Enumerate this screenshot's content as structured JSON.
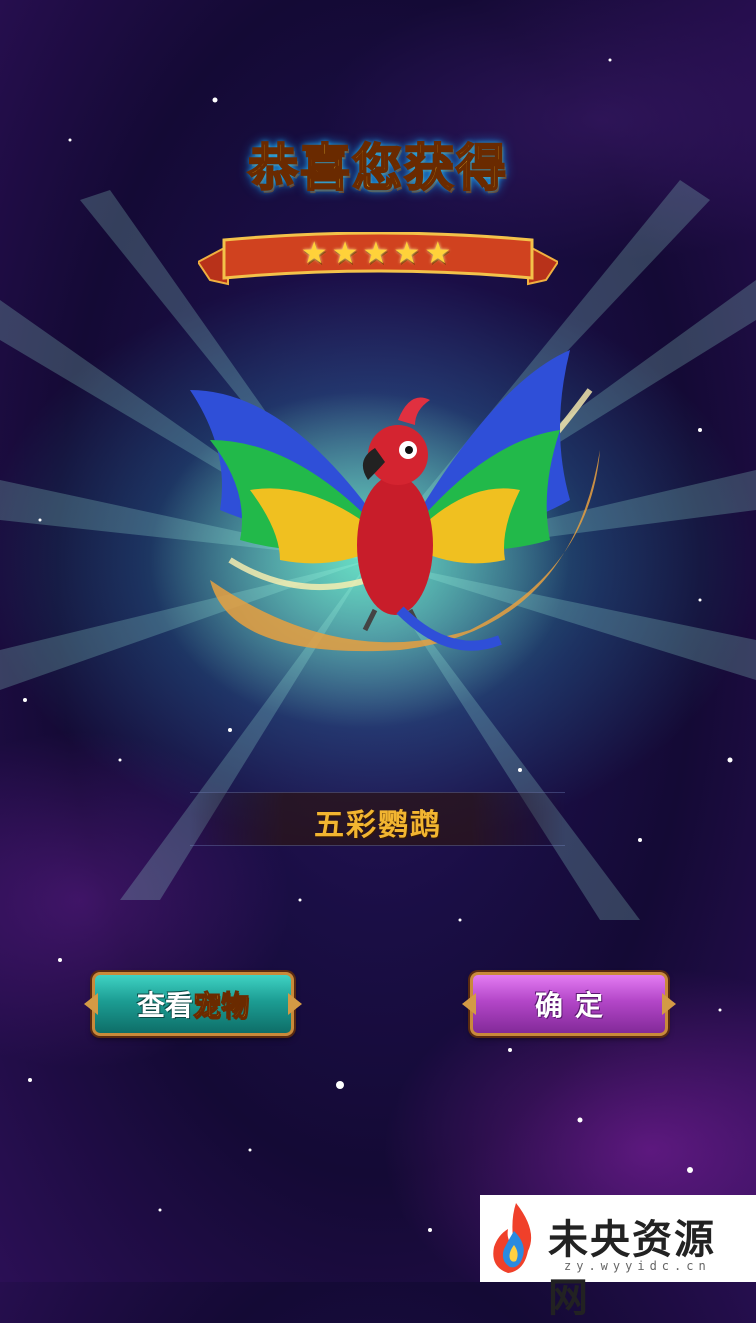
{
  "title": "恭喜您获得",
  "rarity_stars": "★★★★★",
  "rarity_count": 5,
  "pet_name": "五彩鹦鹉",
  "buttons": {
    "view_prefix": "查看",
    "view_highlight": "宠物",
    "confirm": "确定"
  },
  "watermark": {
    "text": "未央资源网",
    "url": "zy.wyyidc.cn"
  },
  "colors": {
    "title_gold": "#ffd93a",
    "teal_button": "#1c9d93",
    "purple_button": "#b346c8",
    "glow": "#3cf0c8"
  },
  "icons": {
    "pet": "rainbow-parrot-icon",
    "watermark_logo": "flame-logo-icon"
  }
}
